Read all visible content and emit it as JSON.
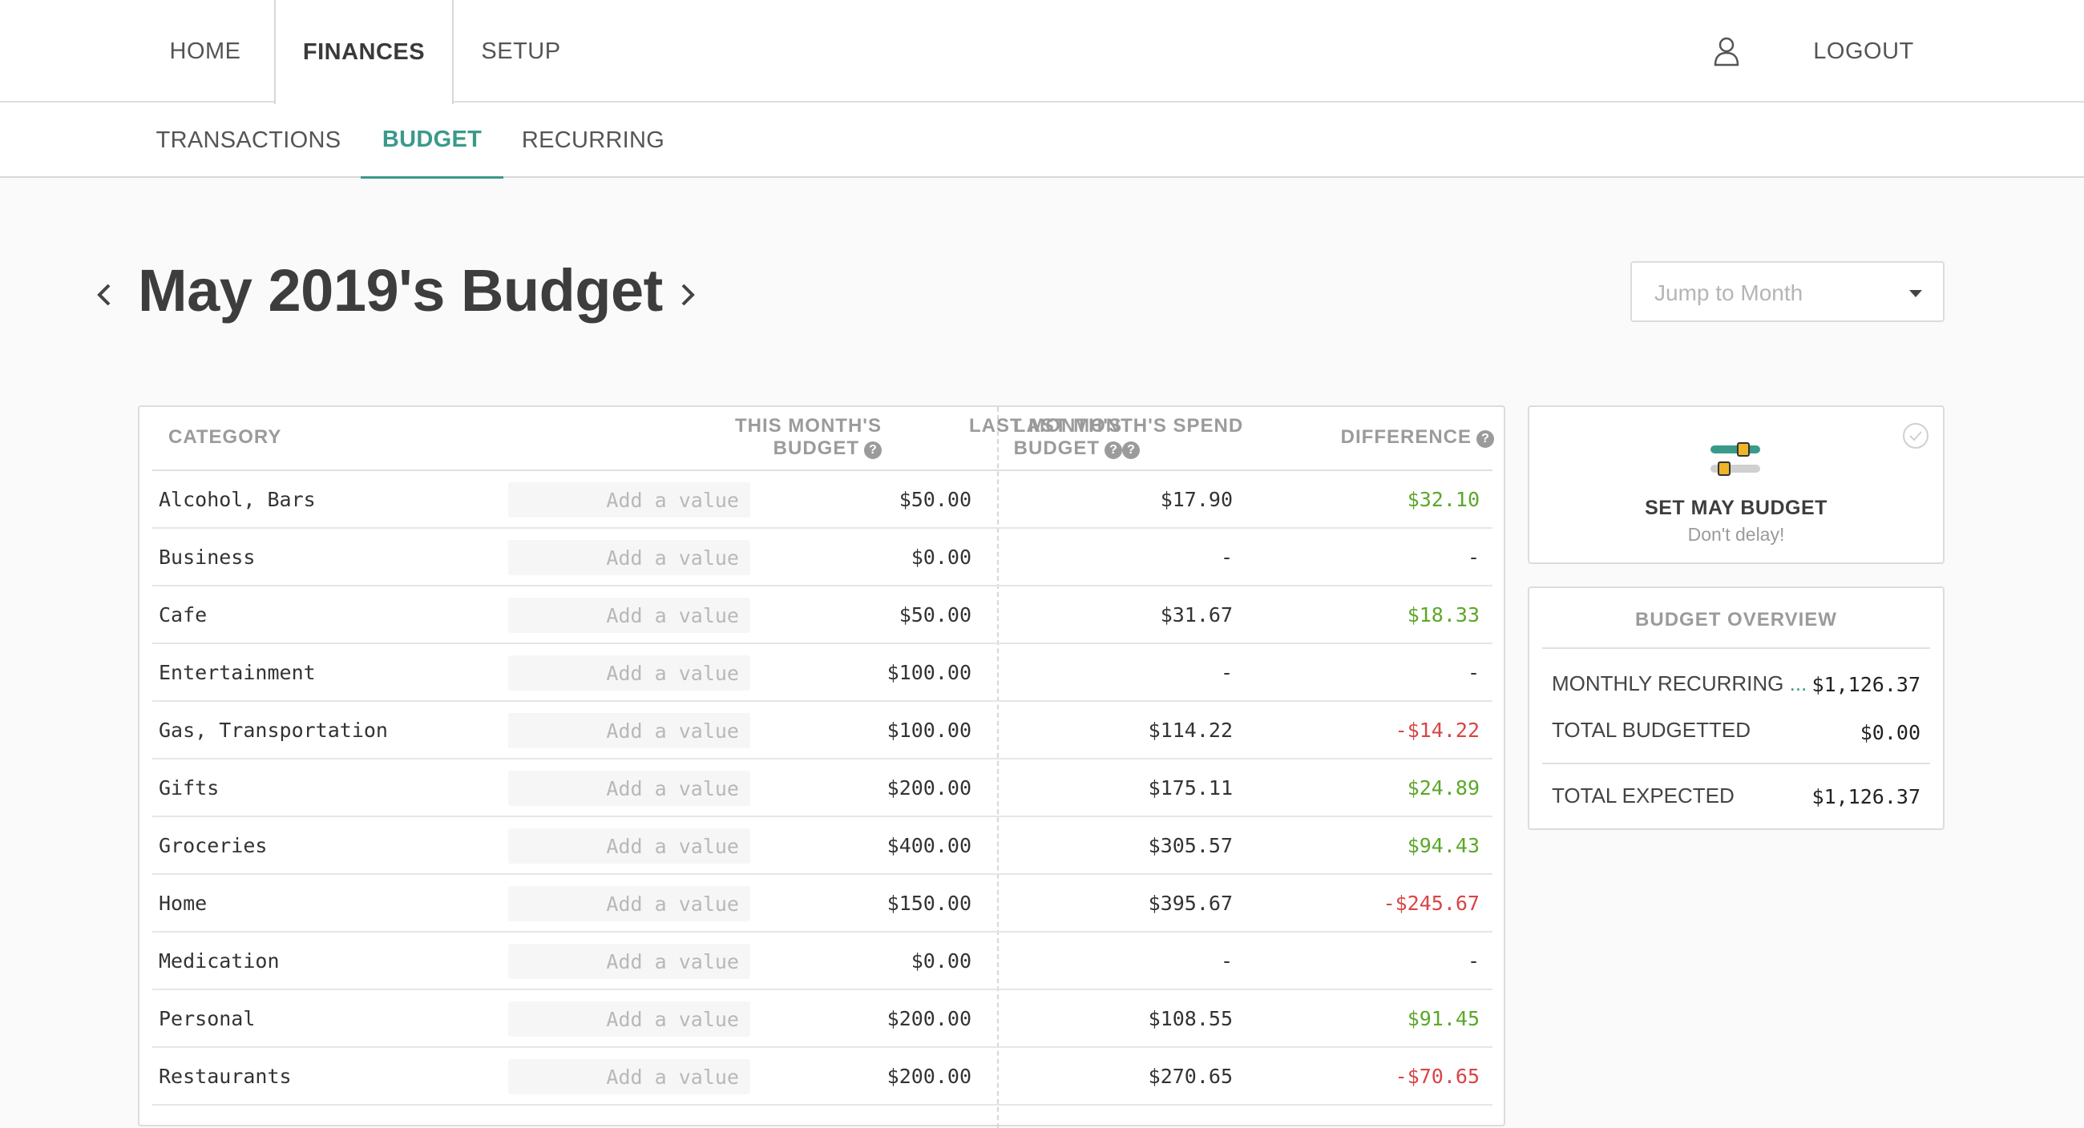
{
  "topnav": {
    "tabs": [
      {
        "label": "HOME"
      },
      {
        "label": "FINANCES"
      },
      {
        "label": "SETUP"
      }
    ],
    "active_tab": "FINANCES",
    "user_icon": "user-icon",
    "logout_label": "LOGOUT"
  },
  "subnav": {
    "tabs": [
      {
        "label": "TRANSACTIONS"
      },
      {
        "label": "BUDGET"
      },
      {
        "label": "RECURRING"
      }
    ],
    "active_tab": "BUDGET"
  },
  "header": {
    "title": "May 2019's Budget",
    "jump_placeholder": "Jump to Month"
  },
  "table": {
    "headers": {
      "category": "CATEGORY",
      "this_month_line1": "THIS MONTH'S",
      "this_month_line2": "BUDGET",
      "last_budget_line1": "LAST MONTH'S",
      "last_budget_line2": "BUDGET",
      "last_spend": "LAST MONTH'S SPEND",
      "difference": "DIFFERENCE"
    },
    "input_placeholder": "Add a value",
    "rows": [
      {
        "category": "Alcohol, Bars",
        "last_budget": "$50.00",
        "last_spend": "$17.90",
        "difference": "$32.10",
        "sign": "pos"
      },
      {
        "category": "Business",
        "last_budget": "$0.00",
        "last_spend": "-",
        "difference": "-",
        "sign": "none"
      },
      {
        "category": "Cafe",
        "last_budget": "$50.00",
        "last_spend": "$31.67",
        "difference": "$18.33",
        "sign": "pos"
      },
      {
        "category": "Entertainment",
        "last_budget": "$100.00",
        "last_spend": "-",
        "difference": "-",
        "sign": "none"
      },
      {
        "category": "Gas, Transportation",
        "last_budget": "$100.00",
        "last_spend": "$114.22",
        "difference": "-$14.22",
        "sign": "neg"
      },
      {
        "category": "Gifts",
        "last_budget": "$200.00",
        "last_spend": "$175.11",
        "difference": "$24.89",
        "sign": "pos"
      },
      {
        "category": "Groceries",
        "last_budget": "$400.00",
        "last_spend": "$305.57",
        "difference": "$94.43",
        "sign": "pos"
      },
      {
        "category": "Home",
        "last_budget": "$150.00",
        "last_spend": "$395.67",
        "difference": "-$245.67",
        "sign": "neg"
      },
      {
        "category": "Medication",
        "last_budget": "$0.00",
        "last_spend": "-",
        "difference": "-",
        "sign": "none"
      },
      {
        "category": "Personal",
        "last_budget": "$200.00",
        "last_spend": "$108.55",
        "difference": "$91.45",
        "sign": "pos"
      },
      {
        "category": "Restaurants",
        "last_budget": "$200.00",
        "last_spend": "$270.65",
        "difference": "-$70.65",
        "sign": "neg"
      }
    ]
  },
  "set_budget": {
    "title": "SET MAY BUDGET",
    "subtitle": "Don't delay!",
    "icon": "sliders-icon"
  },
  "overview": {
    "title": "BUDGET OVERVIEW",
    "monthly_recurring_label": "MONTHLY RECURRING",
    "monthly_recurring_more": "...",
    "monthly_recurring_value": "$1,126.37",
    "total_budgetted_label": "TOTAL BUDGETTED",
    "total_budgetted_value": "$0.00",
    "total_expected_label": "TOTAL EXPECTED",
    "total_expected_value": "$1,126.37"
  },
  "colors": {
    "accent": "#3a9a8a",
    "positive": "#5ba829",
    "negative": "#d94545"
  }
}
